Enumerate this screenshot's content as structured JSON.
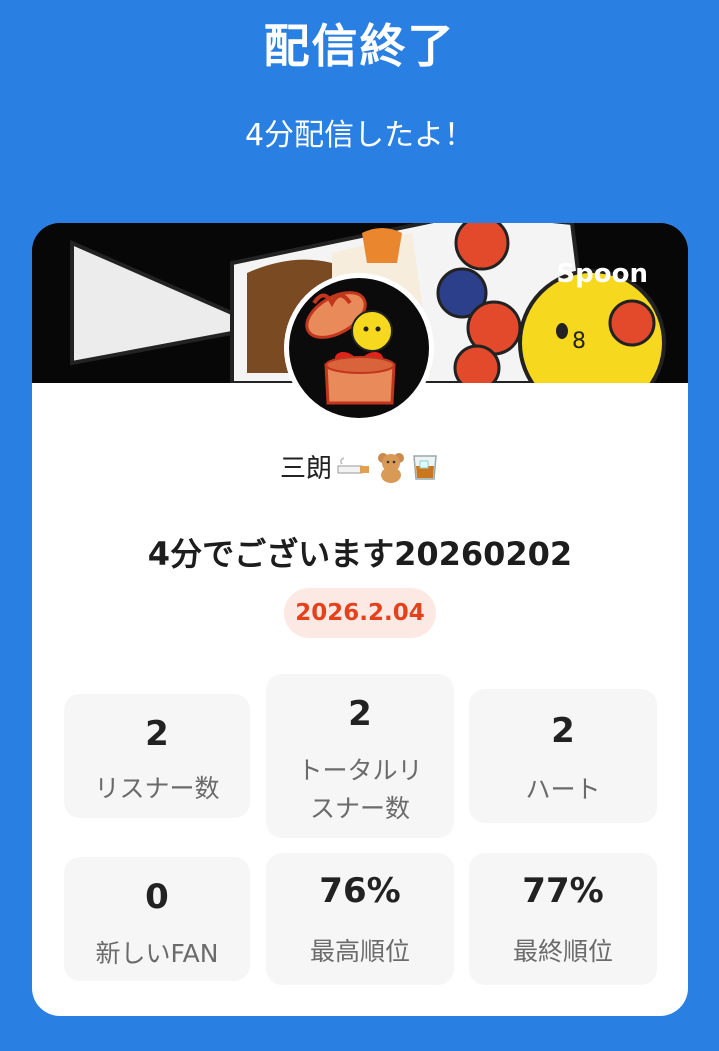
{
  "header": {
    "title": "配信終了",
    "subtitle": "4分配信したよ！"
  },
  "card": {
    "brand": "Spoon",
    "username": "三朗",
    "username_emojis": [
      "cigarette-icon",
      "teddy-bear-icon",
      "whisky-glass-icon"
    ],
    "live_title": "4分でございます20260202",
    "date": "2026.2.04",
    "stats": [
      {
        "value": "2",
        "label": "リスナー数"
      },
      {
        "value": "2",
        "label": "トータルリスナー数"
      },
      {
        "value": "2",
        "label": "ハート"
      },
      {
        "value": "0",
        "label": "新しいFAN"
      },
      {
        "value": "76%",
        "label": "最高順位"
      },
      {
        "value": "77%",
        "label": "最終順位"
      }
    ]
  },
  "colors": {
    "background": "#2a7fe2",
    "card": "#ffffff",
    "date_badge_bg": "#fde9e4",
    "date_badge_text": "#e4421c",
    "stat_bg": "#f6f6f6"
  }
}
